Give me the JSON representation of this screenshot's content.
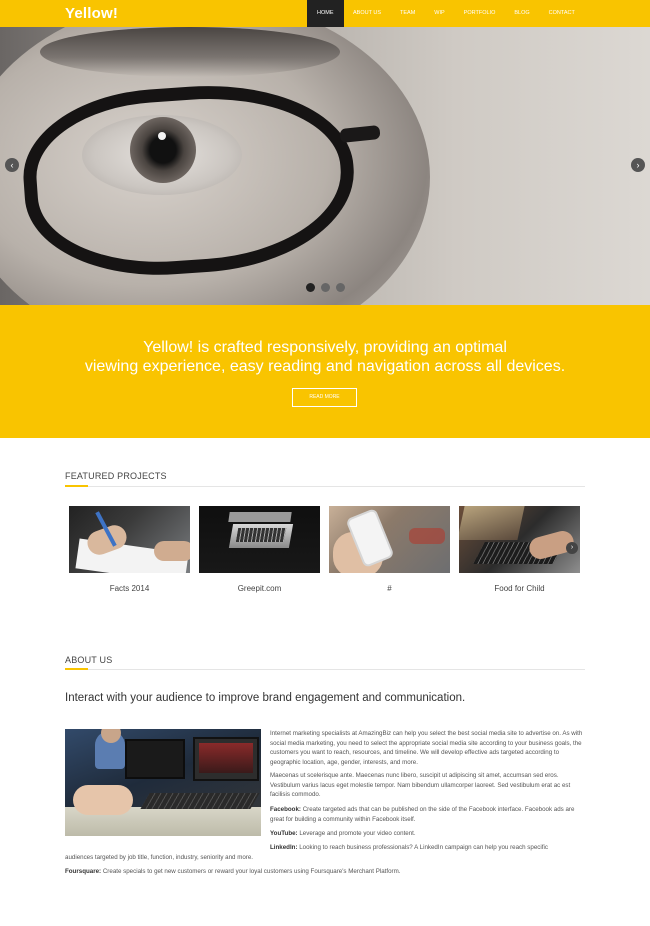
{
  "brand": "Yellow!",
  "nav": {
    "items": [
      "HOME",
      "ABOUT US",
      "TEAM",
      "WIP",
      "PORTFOLIO",
      "BLOG",
      "CONTACT"
    ],
    "active_index": 0
  },
  "hero": {
    "prev_arrow": "‹",
    "next_arrow": "›",
    "slide_count": 3,
    "active_slide": 0
  },
  "banner": {
    "line1": "Yellow! is crafted responsively, providing an optimal",
    "line2": "viewing experience, easy reading and navigation across all devices.",
    "button": "READ MORE"
  },
  "featured": {
    "title": "FEATURED PROJECTS",
    "projects": [
      {
        "label": "Facts 2014"
      },
      {
        "label": "Greepit.com"
      },
      {
        "label": "#"
      },
      {
        "label": "Food for Child"
      }
    ],
    "next_arrow": "›"
  },
  "about": {
    "title": "ABOUT US",
    "heading": "Interact with your audience to improve brand engagement and communication.",
    "para1": "Internet marketing specialists at AmazingBiz can help you select the best social media site to advertise on. As with social media marketing, you need to select the appropriate social media site according to your business goals, the customers you want to reach, resources, and timeline. We will develop effective ads targeted according to geographic location, age, gender, interests, and more.",
    "para2": "Maecenas ut scelerisque ante. Maecenas nunc libero, suscipit ut adipiscing sit amet, accumsan sed eros. Vestibulum varius lacus eget molestie tempor. Nam bibendum ullamcorper laoreet. Sed vestibulum erat ac est facilisis commodo.",
    "facebook_label": "Facebook:",
    "facebook_text": "Create targeted ads that can be published on the side of the Facebook interface. Facebook ads are great for building a community within Facebook itself.",
    "youtube_label": "YouTube:",
    "youtube_text": "Leverage and promote your video content.",
    "linkedin_label": "LinkedIn:",
    "linkedin_text_1": "Looking to reach business professionals? A LinkedIn campaign can help you reach specific",
    "linkedin_text_2": "audiences targeted by job title, function, industry, seniority and more.",
    "foursquare_label": "Foursquare:",
    "foursquare_text": "Create specials to get new customers or reward your loyal customers using Foursquare's Merchant Platform."
  },
  "colors": {
    "accent": "#f9c400",
    "nav_active": "#222222"
  }
}
